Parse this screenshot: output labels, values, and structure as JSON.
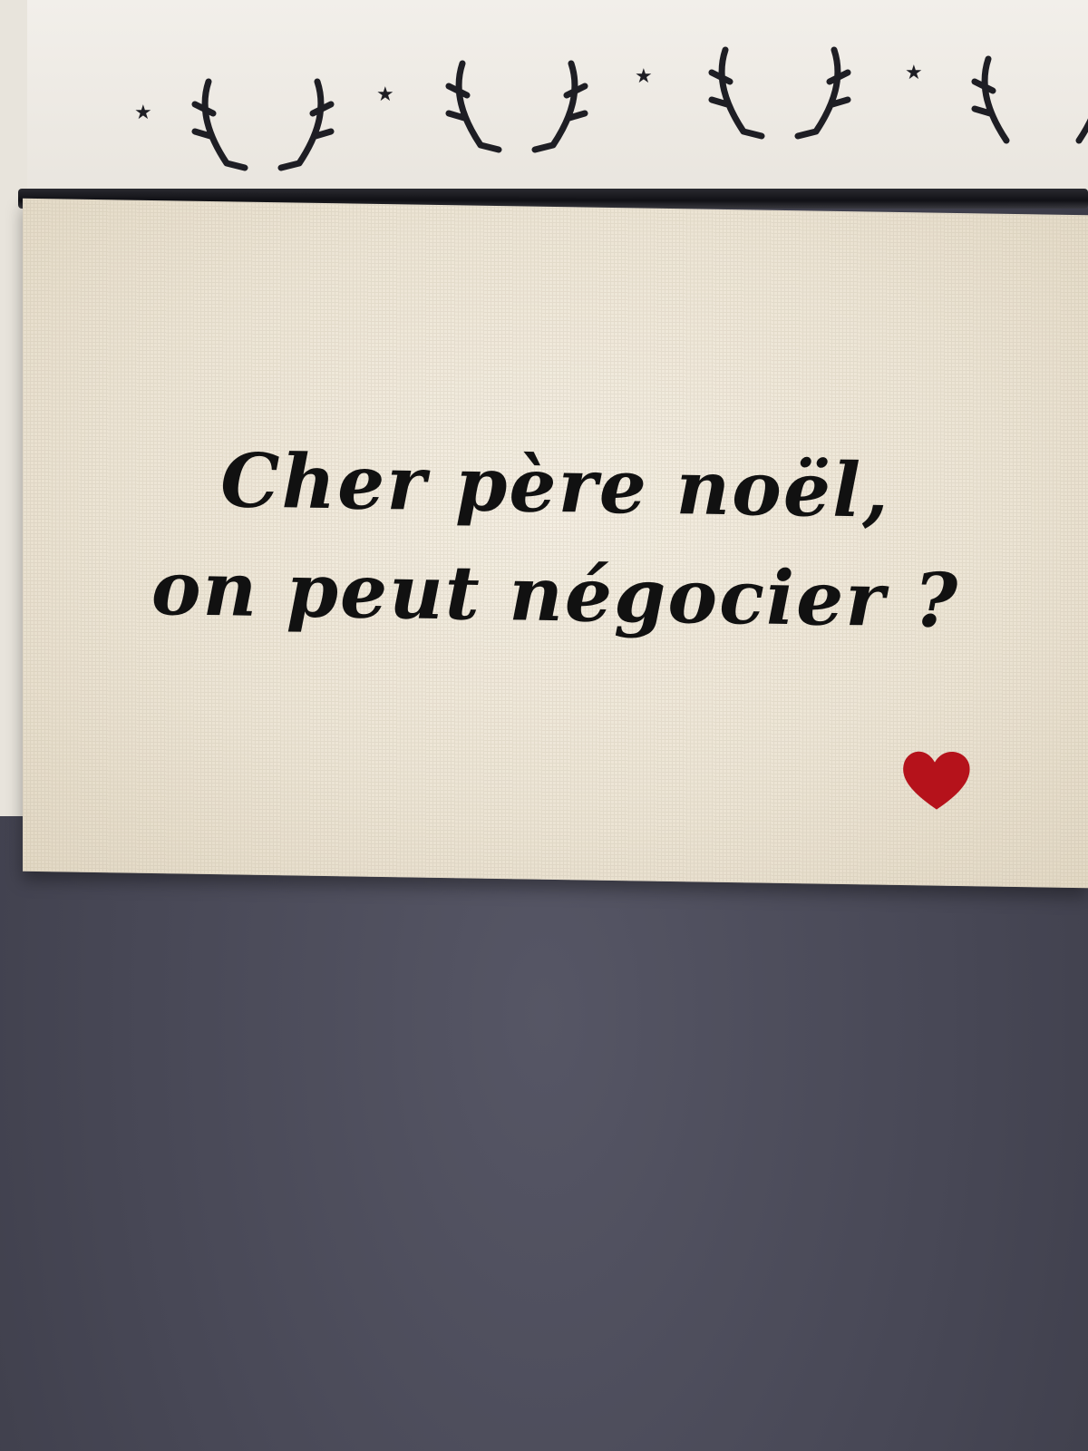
{
  "photo": {
    "message": {
      "line1": "Cher père noël,",
      "line2": "on peut négocier ?"
    },
    "colors": {
      "canvas": "#ece4d4",
      "text": "#111111",
      "heart": "#b5121b",
      "surface": "#4a4a58",
      "zipper": "#111116"
    },
    "icons": [
      "antler-icon",
      "star-icon",
      "heart-icon"
    ]
  }
}
